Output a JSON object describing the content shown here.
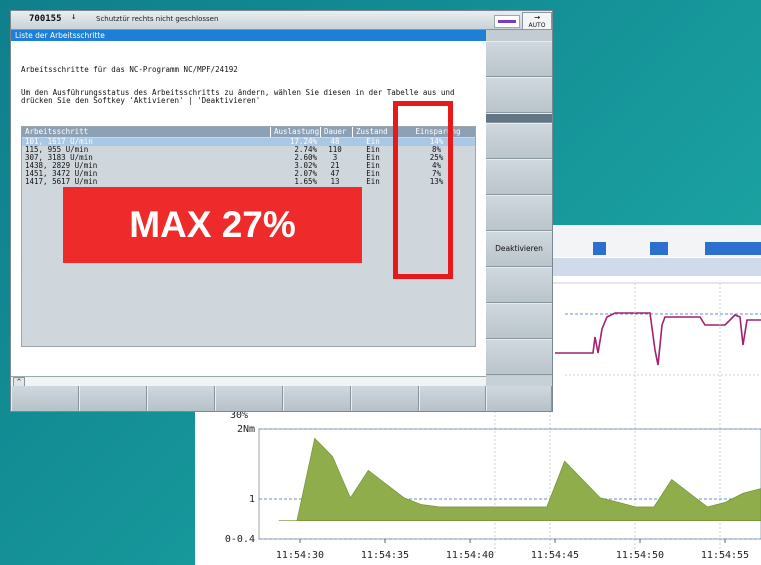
{
  "hmi": {
    "program_number": "700155",
    "status_message": "Schutztür rechts nicht geschlossen",
    "mode_label": "AUTO",
    "window_title": "Liste der Arbeitsschritte",
    "heading": "Arbeitsschritte für das NC-Programm NC/MPF/24192",
    "instruction_line1": "Um den Ausführungsstatus des Arbeitsschritts zu ändern, wählen Sie diesen in der Tabelle aus und",
    "instruction_line2": "drücken Sie den Softkey 'Aktivieren' | 'Deaktivieren'",
    "softkey_deactivate": "Deaktivieren",
    "table": {
      "headers": [
        "Arbeitsschritt",
        "Auslastung",
        "Dauer",
        "Zustand",
        "Einsparung"
      ],
      "rows": [
        {
          "step": "101, 1617 U/min",
          "load": "17.24%",
          "duration": "48",
          "state": "Ein",
          "saving": "14%"
        },
        {
          "step": "115, 955 U/min",
          "load": "2.74%",
          "duration": "110",
          "state": "Ein",
          "saving": "8%"
        },
        {
          "step": "307, 3183 U/min",
          "load": "2.60%",
          "duration": "3",
          "state": "Ein",
          "saving": "25%"
        },
        {
          "step": "1438, 2829 U/min",
          "load": "3.02%",
          "duration": "21",
          "state": "Ein",
          "saving": "4%"
        },
        {
          "step": "1451, 3472 U/min",
          "load": "2.07%",
          "duration": "47",
          "state": "Ein",
          "saving": "7%"
        },
        {
          "step": "1417, 5617 U/min",
          "load": "1.65%",
          "duration": "13",
          "state": "Ein",
          "saving": "13%"
        }
      ]
    }
  },
  "overlay": {
    "banner": "MAX 27%",
    "highlight_color": "#e8191a"
  },
  "chart": {
    "colors": {
      "torque_fill": "#8fad4a",
      "speed_line": "#a3206f",
      "markers": "#2c6fcf"
    },
    "upper_tick": "30%",
    "y_ticks": [
      "2Nm",
      "1",
      "0-0.4"
    ],
    "x_ticks": [
      "11:54:30",
      "11:54:35",
      "11:54:40",
      "11:54:45",
      "11:54:50",
      "11:54:55"
    ]
  },
  "chart_data": {
    "type": "area",
    "ylabel": "Nm",
    "ylim": [
      -0.4,
      2
    ],
    "x": [
      "11:54:28",
      "11:54:30",
      "11:54:31",
      "11:54:32",
      "11:54:33",
      "11:54:34",
      "11:54:35",
      "11:54:36",
      "11:54:37",
      "11:54:38",
      "11:54:39",
      "11:54:40",
      "11:54:41",
      "11:54:42",
      "11:54:43",
      "11:54:44",
      "11:54:45",
      "11:54:46",
      "11:54:47",
      "11:54:48",
      "11:54:49",
      "11:54:50",
      "11:54:51",
      "11:54:52",
      "11:54:53",
      "11:54:54",
      "11:54:55",
      "11:54:56"
    ],
    "series": [
      {
        "values": [
          0,
          0,
          1.8,
          1.4,
          0.5,
          1.1,
          0.8,
          0.5,
          0.35,
          0.3,
          0.3,
          0.3,
          0.3,
          0.3,
          0.3,
          0.3,
          1.3,
          0.9,
          0.5,
          0.4,
          0.3,
          0.3,
          0.9,
          0.6,
          0.3,
          0.4,
          0.6,
          0.7
        ]
      }
    ]
  }
}
